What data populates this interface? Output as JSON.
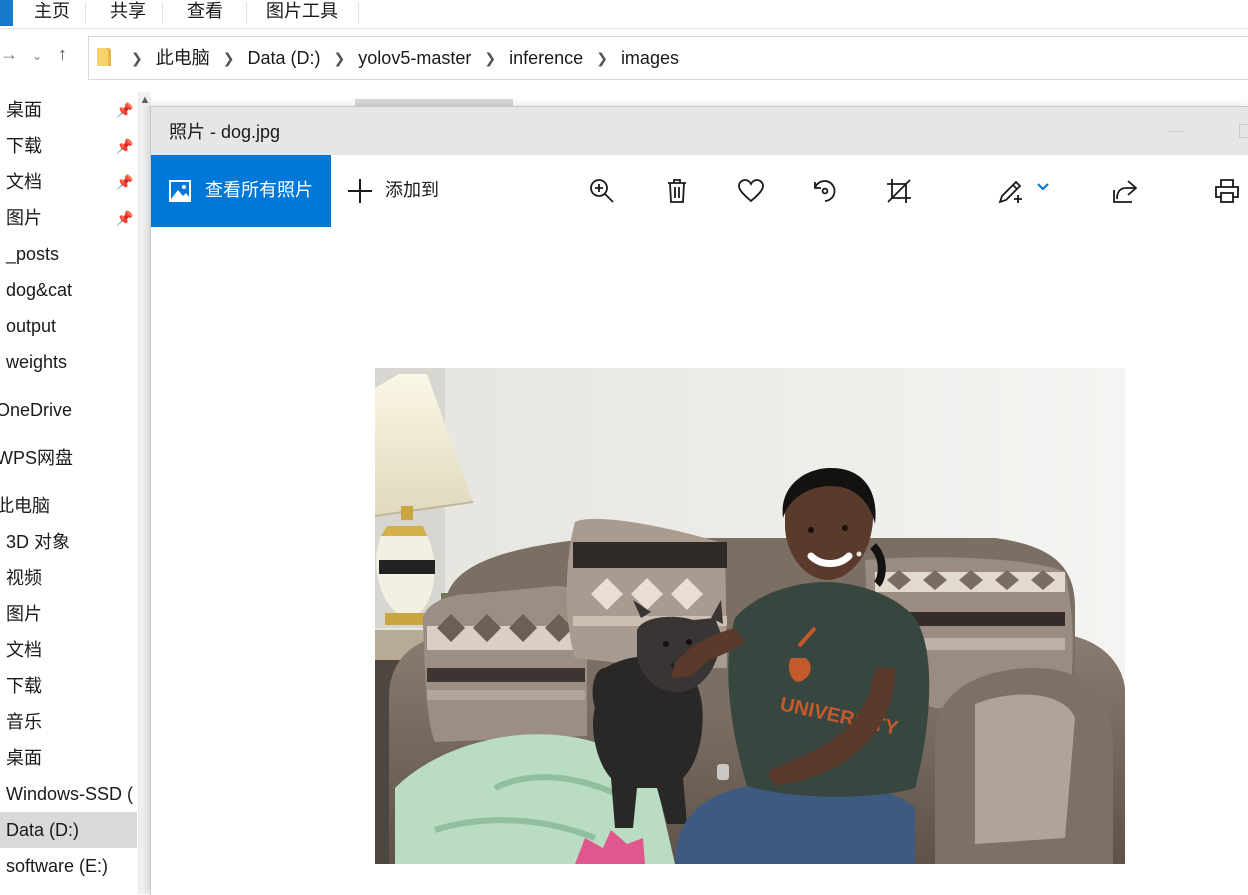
{
  "ribbon": {
    "tabs": [
      "主页",
      "共享",
      "查看",
      "图片工具"
    ]
  },
  "address_bar": {
    "crumbs": [
      "此电脑",
      "Data (D:)",
      "yolov5-master",
      "inference",
      "images"
    ]
  },
  "nav_pane": {
    "quick_access": [
      {
        "label": "桌面",
        "pinned": true
      },
      {
        "label": "下载",
        "pinned": true
      },
      {
        "label": "文档",
        "pinned": true
      },
      {
        "label": "图片",
        "pinned": true
      },
      {
        "label": "_posts",
        "pinned": false
      },
      {
        "label": "dog&cat",
        "pinned": false
      },
      {
        "label": "output",
        "pinned": false
      },
      {
        "label": "weights",
        "pinned": false
      }
    ],
    "onedrive": "OneDrive",
    "wps": "WPS网盘",
    "this_pc": "此电脑",
    "pc_items": [
      {
        "label": "3D 对象"
      },
      {
        "label": "视频"
      },
      {
        "label": "图片"
      },
      {
        "label": "文档"
      },
      {
        "label": "下载"
      },
      {
        "label": "音乐"
      },
      {
        "label": "桌面"
      },
      {
        "label": "Windows-SSD ("
      },
      {
        "label": "Data (D:)",
        "selected": true
      },
      {
        "label": "software (E:)"
      }
    ]
  },
  "photos_app": {
    "title": "照片 - dog.jpg",
    "view_all_label": "查看所有照片",
    "add_to_label": "添加到",
    "accent_color": "#0078d7",
    "toolbar_icons": [
      "zoom-in-icon",
      "delete-icon",
      "favorite-icon",
      "rotate-icon",
      "crop-icon",
      "edit-icon",
      "share-icon",
      "print-icon"
    ]
  },
  "photo": {
    "file_name": "dog.jpg",
    "shirt_text": "UNIVERSITY"
  }
}
